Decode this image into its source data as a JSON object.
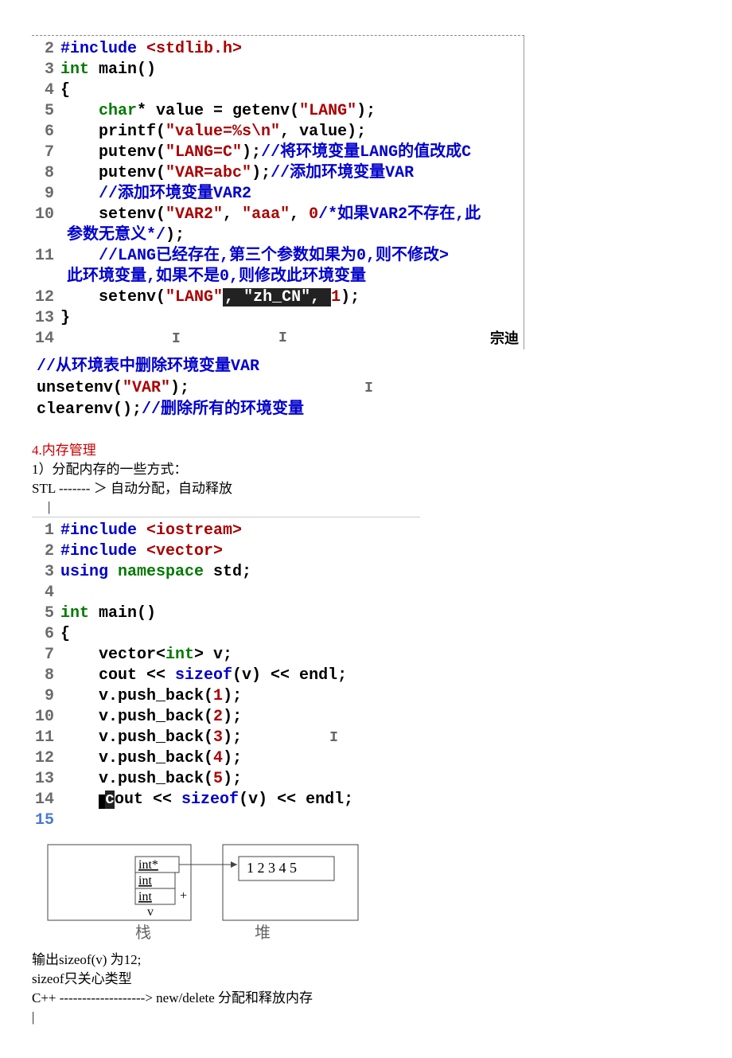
{
  "code1": {
    "l2": {
      "n": "2",
      "pre": "#include ",
      "hdr": "<stdlib.h>"
    },
    "l3": {
      "n": "3",
      "t1": "int",
      "t2": " main()"
    },
    "l4": {
      "n": "4",
      "br": "{"
    },
    "l5": {
      "n": "5",
      "indent": "    ",
      "kw": "char",
      "rest": "* value = getenv(",
      "str": "\"LANG\"",
      "tail": ");"
    },
    "l6": {
      "n": "6",
      "indent": "    ",
      "fn": "printf(",
      "str": "\"value=%s\\n\"",
      "tail": ", value);"
    },
    "l7": {
      "n": "7",
      "indent": "    ",
      "fn": "putenv(",
      "str": "\"LANG=C\"",
      "tail": ");",
      "cmt": "//将环境变量LANG的值改成C"
    },
    "l8": {
      "n": "8",
      "indent": "    ",
      "fn": "putenv(",
      "str": "\"VAR=abc\"",
      "tail": ");",
      "cmt": "//添加环境变量VAR"
    },
    "l9": {
      "n": "9",
      "indent": "    ",
      "cmt": "//添加环境变量VAR2"
    },
    "l10": {
      "n": "10",
      "indent": "    ",
      "fn": "setenv(",
      "s1": "\"VAR2\"",
      "c1": ", ",
      "s2": "\"aaa\"",
      "c2": ", ",
      "num": "0",
      "cinner": "/*如果VAR2不存在,此",
      "tail": ""
    },
    "l10b": {
      "cont": "参数无意义*/",
      "tail": ");"
    },
    "l11": {
      "n": "11",
      "indent": "    ",
      "cmt1": "//LANG已经存在,第三个参数如果为0,则不修改>"
    },
    "l11b": {
      "cont": "此环境变量,如果不是0,则修改此环境变量"
    },
    "l12": {
      "n": "12",
      "indent": "    ",
      "fn": "setenv(",
      "s1": "\"LANG\"",
      "c1": ", ",
      "s2": "\"zh_CN\"",
      "c2": ", ",
      "num": "1",
      "tail": ");"
    },
    "l13": {
      "n": "13",
      "br": "}"
    },
    "l14": {
      "n": "14"
    },
    "annot": "宗迪"
  },
  "snippet": {
    "l1cmt": "//从环境表中删除环境变量VAR",
    "l2a": "unsetenv(",
    "l2s": "\"VAR\"",
    "l2b": ");",
    "l3a": "clearenv();",
    "l3cmt": "//删除所有的环境变量"
  },
  "section": {
    "title": "4.内存管理",
    "p1": "1）分配内存的一些方式：",
    "p2": " STL ------- ＞ 自动分配，自动释放",
    "bar": "|"
  },
  "code2": {
    "l1": {
      "n": "1",
      "pre": "#include ",
      "hdr": "<iostream>"
    },
    "l2": {
      "n": "2",
      "pre": "#include ",
      "hdr": "<vector>"
    },
    "l3": {
      "n": "3",
      "u": "using ",
      "ns": "namespace ",
      "std": "std;"
    },
    "l4": {
      "n": "4"
    },
    "l5": {
      "n": "5",
      "kw": "int",
      "rest": " main()"
    },
    "l6": {
      "n": "6",
      "br": "{"
    },
    "l7": {
      "n": "7",
      "indent": "    ",
      "a": "vector<",
      "kw": "int",
      "b": "> v;"
    },
    "l8": {
      "n": "8",
      "indent": "    ",
      "a": "cout << ",
      "sz": "sizeof",
      "b": "(v) << endl;"
    },
    "l9": {
      "n": "9",
      "indent": "    ",
      "t": "v.push_back(",
      "num": "1",
      "e": ");"
    },
    "l10": {
      "n": "10",
      "indent": "    ",
      "t": "v.push_back(",
      "num": "2",
      "e": ");"
    },
    "l11": {
      "n": "11",
      "indent": "    ",
      "t": "v.push_back(",
      "num": "3",
      "e": ");"
    },
    "l12": {
      "n": "12",
      "indent": "    ",
      "t": "v.push_back(",
      "num": "4",
      "e": ");"
    },
    "l13": {
      "n": "13",
      "indent": "    ",
      "t": "v.push_back(",
      "num": "5",
      "e": ");"
    },
    "l14": {
      "n": "14",
      "indent": "    ",
      "a": "out << ",
      "sz": "sizeof",
      "b": "(v) << endl;",
      "curC": "c"
    },
    "l15": {
      "n": "15"
    }
  },
  "diagram": {
    "intp": "int*",
    "int1": "int",
    "int2": "int",
    "v": "v",
    "nums": "1 2 3 4 5",
    "stack": "栈",
    "heap": "堆"
  },
  "footer": {
    "p1": "输出sizeof(v) 为12;",
    "p2": "sizeof只关心类型",
    "p3": "C++ -------------------> new/delete   分配和释放内存",
    "bar": "|"
  }
}
